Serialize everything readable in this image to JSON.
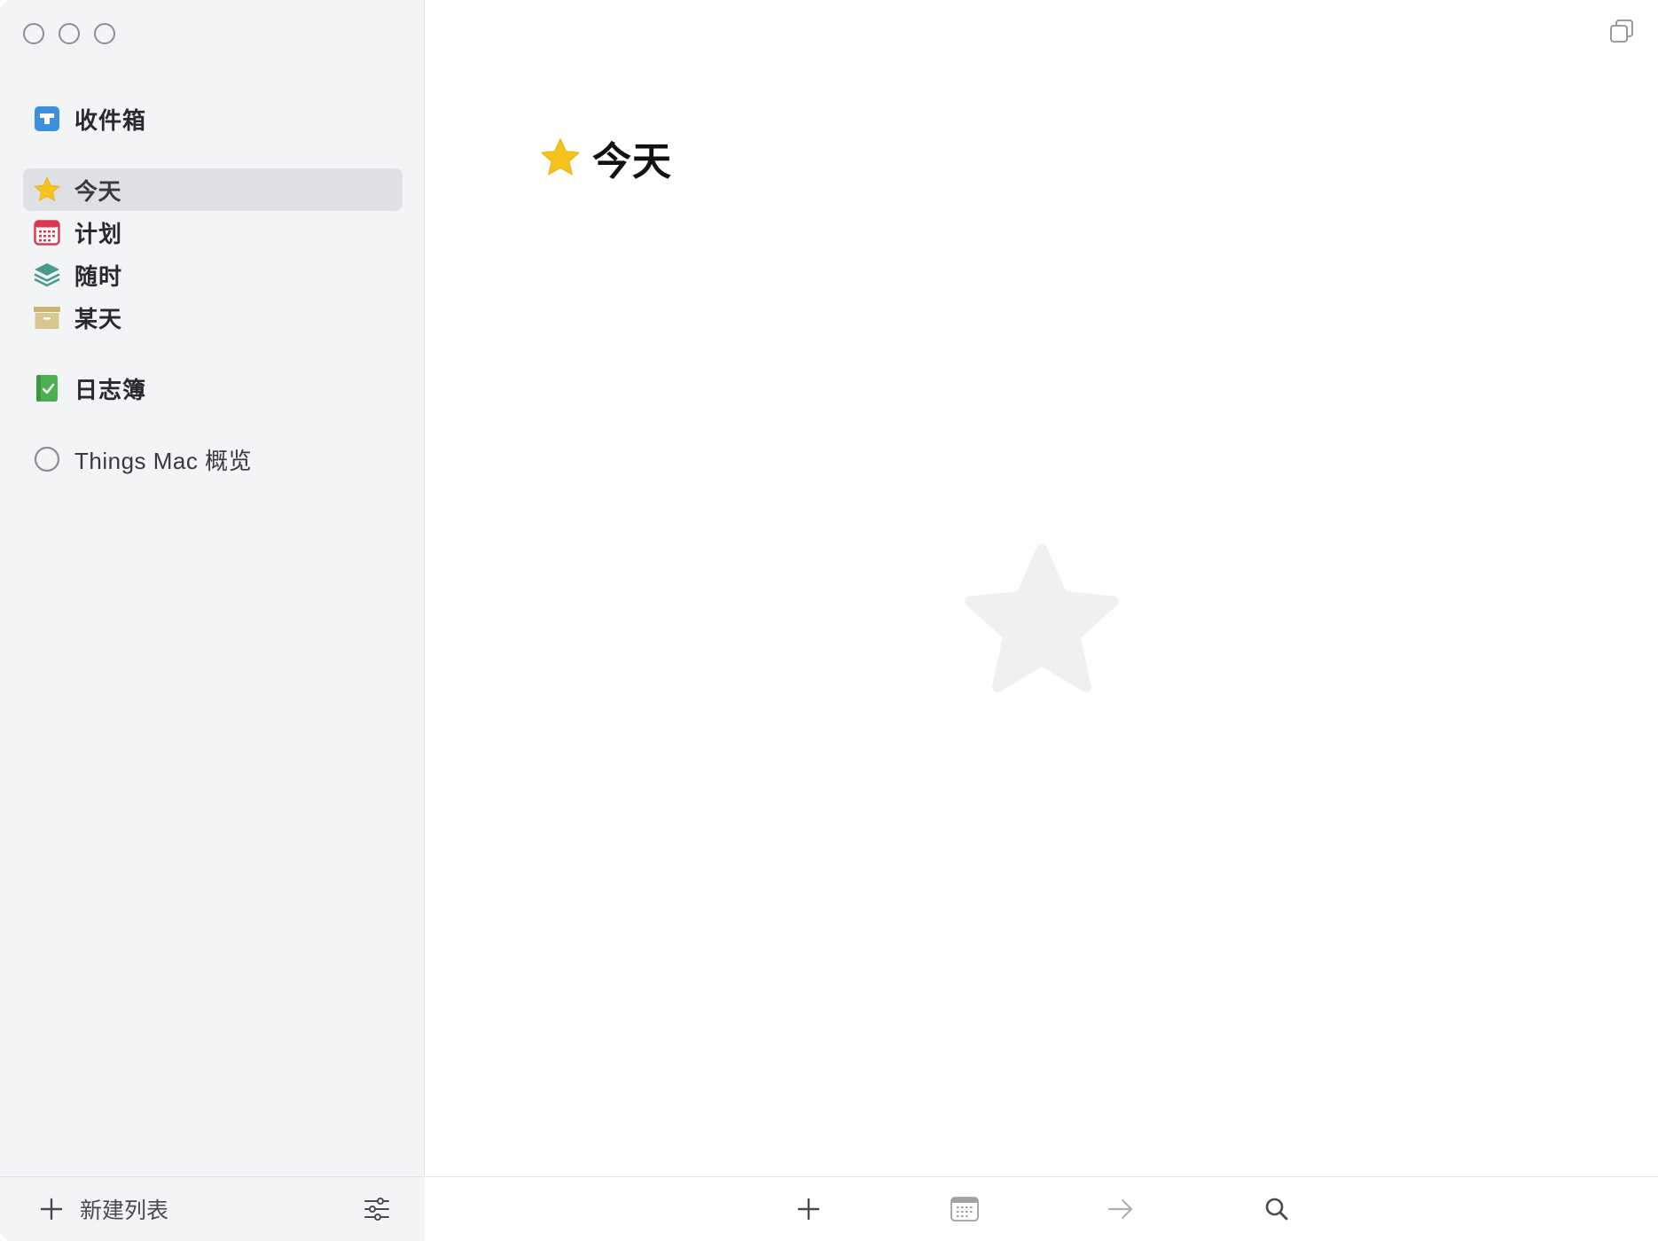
{
  "window": {
    "controls": [
      "close",
      "minimize",
      "zoom"
    ]
  },
  "sidebar": {
    "items": [
      {
        "id": "inbox",
        "label": "收件箱",
        "icon": "inbox-icon",
        "color": "#3d8fe0"
      },
      {
        "id": "today",
        "label": "今天",
        "icon": "star-icon",
        "color": "#f5c31b",
        "active": true
      },
      {
        "id": "upcoming",
        "label": "计划",
        "icon": "calendar-icon",
        "color": "#d8394f"
      },
      {
        "id": "anytime",
        "label": "随时",
        "icon": "layers-icon",
        "color": "#4a9a8f"
      },
      {
        "id": "someday",
        "label": "某天",
        "icon": "archive-box-icon",
        "color": "#c9b474"
      },
      {
        "id": "logbook",
        "label": "日志簿",
        "icon": "logbook-icon",
        "color": "#4caf50"
      },
      {
        "id": "project",
        "label": "Things Mac 概览",
        "icon": "project-circle-icon",
        "color": "#8e8e92"
      }
    ],
    "footer": {
      "new_list_label": "新建列表",
      "new_list_icon": "plus-icon",
      "filter_icon": "sliders-icon"
    }
  },
  "main": {
    "title": "今天",
    "title_icon": "star-icon",
    "empty_state_icon": "star-icon",
    "toolbar": {
      "buttons": [
        {
          "id": "add",
          "icon": "plus-icon"
        },
        {
          "id": "when",
          "icon": "calendar-icon"
        },
        {
          "id": "move",
          "icon": "arrow-right-icon"
        },
        {
          "id": "search",
          "icon": "search-icon"
        }
      ]
    },
    "copy_icon": "window-copy-icon"
  }
}
